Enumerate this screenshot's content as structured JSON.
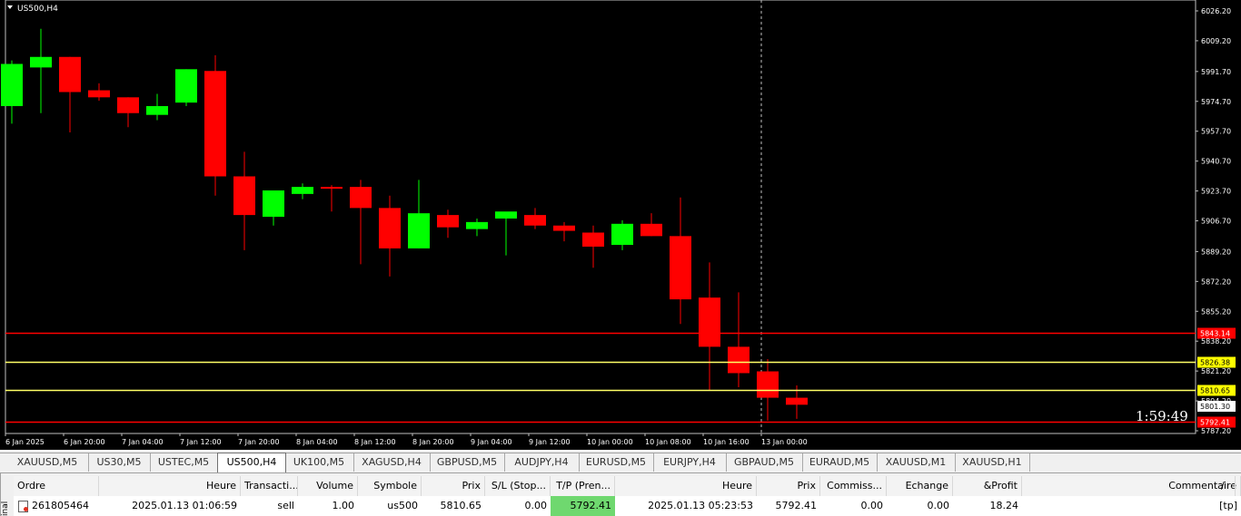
{
  "chart": {
    "symbol_label": "US500,H4",
    "countdown": "1:59:49",
    "price_min": 5787.2,
    "price_max": 6032.0,
    "price_ticks": [
      "6026.20",
      "6009.20",
      "5991.70",
      "5974.70",
      "5957.70",
      "5940.70",
      "5923.70",
      "5906.70",
      "5889.20",
      "5872.20",
      "5855.20",
      "5838.20",
      "5821.20",
      "5804.20",
      "5787.20"
    ],
    "time_labels": [
      "6 Jan 2025",
      "6 Jan 20:00",
      "7 Jan 04:00",
      "7 Jan 12:00",
      "7 Jan 20:00",
      "8 Jan 04:00",
      "8 Jan 12:00",
      "8 Jan 20:00",
      "9 Jan 04:00",
      "9 Jan 12:00",
      "10 Jan 00:00",
      "10 Jan 08:00",
      "10 Jan 16:00",
      "13 Jan 00:00"
    ],
    "candles": [
      {
        "o": 5972,
        "h": 5998,
        "l": 5962,
        "c": 5996
      },
      {
        "o": 5994,
        "h": 6016,
        "l": 5968,
        "c": 6000
      },
      {
        "o": 6000,
        "h": 6000,
        "l": 5957,
        "c": 5980
      },
      {
        "o": 5981,
        "h": 5985,
        "l": 5975,
        "c": 5977
      },
      {
        "o": 5977,
        "h": 5977,
        "l": 5960,
        "c": 5968
      },
      {
        "o": 5967,
        "h": 5979,
        "l": 5964,
        "c": 5972
      },
      {
        "o": 5974,
        "h": 5993,
        "l": 5972,
        "c": 5993
      },
      {
        "o": 5992,
        "h": 6001,
        "l": 5921,
        "c": 5932
      },
      {
        "o": 5932,
        "h": 5946,
        "l": 5890,
        "c": 5910
      },
      {
        "o": 5909,
        "h": 5924,
        "l": 5904,
        "c": 5924
      },
      {
        "o": 5922,
        "h": 5928,
        "l": 5919,
        "c": 5926
      },
      {
        "o": 5926,
        "h": 5927,
        "l": 5912,
        "c": 5925
      },
      {
        "o": 5926,
        "h": 5930,
        "l": 5882,
        "c": 5914
      },
      {
        "o": 5914,
        "h": 5921,
        "l": 5875,
        "c": 5891
      },
      {
        "o": 5891,
        "h": 5930,
        "l": 5891,
        "c": 5911
      },
      {
        "o": 5910,
        "h": 5913,
        "l": 5897,
        "c": 5903
      },
      {
        "o": 5902,
        "h": 5908,
        "l": 5898,
        "c": 5906
      },
      {
        "o": 5908,
        "h": 5911,
        "l": 5887,
        "c": 5912
      },
      {
        "o": 5910,
        "h": 5914,
        "l": 5902,
        "c": 5904
      },
      {
        "o": 5904,
        "h": 5906,
        "l": 5895,
        "c": 5901
      },
      {
        "o": 5900,
        "h": 5904,
        "l": 5880,
        "c": 5892
      },
      {
        "o": 5893,
        "h": 5907,
        "l": 5890,
        "c": 5905
      },
      {
        "o": 5905,
        "h": 5911,
        "l": 5898,
        "c": 5898
      },
      {
        "o": 5898,
        "h": 5920,
        "l": 5848,
        "c": 5862
      },
      {
        "o": 5863,
        "h": 5883,
        "l": 5810,
        "c": 5835
      },
      {
        "o": 5835,
        "h": 5866,
        "l": 5812,
        "c": 5820
      },
      {
        "o": 5821,
        "h": 5828,
        "l": 5793,
        "c": 5806
      },
      {
        "o": 5806,
        "h": 5813,
        "l": 5794,
        "c": 5802
      }
    ],
    "levels": [
      {
        "price": 5843.14,
        "label": "5843.14",
        "color": "#ff0000",
        "tag_bg": "#ff0000",
        "tag_fg": "#ffffff"
      },
      {
        "price": 5826.38,
        "label": "5826.38",
        "color": "#ffff66",
        "tag_bg": "#ffff00",
        "tag_fg": "#000000"
      },
      {
        "price": 5810.65,
        "label": "5810.65",
        "color": "#ffff66",
        "tag_bg": "#ffff00",
        "tag_fg": "#000000"
      },
      {
        "price": 5792.41,
        "label": "5792.41",
        "color": "#ff0000",
        "tag_bg": "#ff0000",
        "tag_fg": "#ffffff"
      }
    ],
    "bid": {
      "price": 5801.3,
      "label": "5801.30"
    },
    "colors": {
      "bull": "#00ff00",
      "bear": "#ff0000",
      "bg": "#000000",
      "axis_text": "#ffffff"
    }
  },
  "tabs": [
    "XAUUSD,M5",
    "US30,M5",
    "USTEC,M5",
    "US500,H4",
    "UK100,M5",
    "XAGUSD,H4",
    "GBPUSD,M5",
    "AUDJPY,H4",
    "EURUSD,M5",
    "EURJPY,H4",
    "GBPAUD,M5",
    "EURAUD,M5",
    "XAUUSD,M1",
    "XAUUSD,H1"
  ],
  "active_tab": "US500,H4",
  "terminal_label": "inal",
  "table": {
    "headers": [
      "Ordre",
      "Heure",
      "Transacti...",
      "Volume",
      "Symbole",
      "Prix",
      "S/L (Stop...",
      "T/P (Pren...",
      "Heure",
      "Prix",
      "Commiss...",
      "Echange",
      "&Profit",
      "Commentaire"
    ],
    "sort_indicator": "/",
    "row": [
      "261805464",
      "2025.01.13 01:06:59",
      "sell",
      "1.00",
      "us500",
      "5810.65",
      "0.00",
      "5792.41",
      "2025.01.13 05:23:53",
      "5792.41",
      "0.00",
      "0.00",
      "18.24",
      "[tp]"
    ]
  }
}
